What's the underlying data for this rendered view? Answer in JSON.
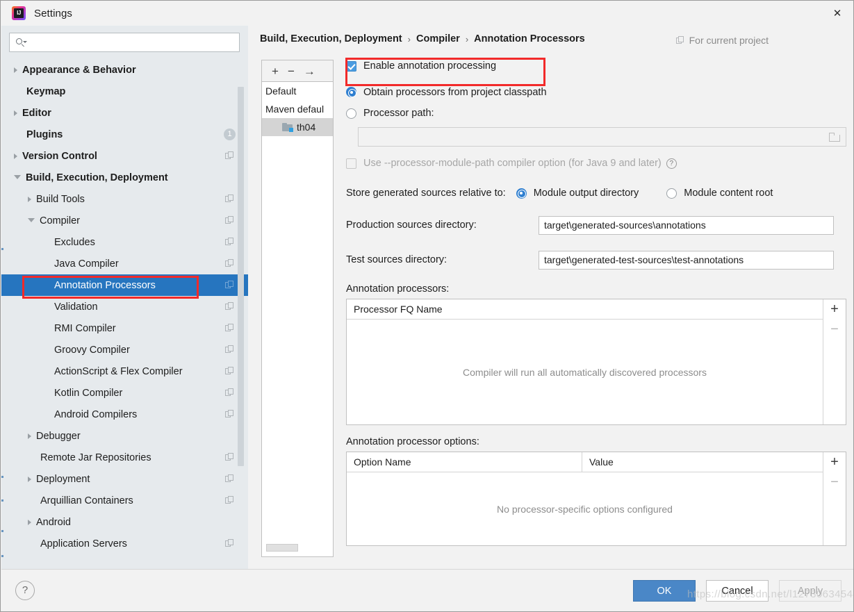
{
  "window": {
    "title": "Settings",
    "logo_icon": "intellij-idea-logo",
    "close_icon": "✕"
  },
  "search": {
    "value": "",
    "placeholder": "",
    "icon": "search-icon"
  },
  "sidebar": {
    "items": [
      {
        "label": "Appearance & Behavior",
        "arrow": "right",
        "bold": true,
        "indent": 0,
        "copy": false,
        "badge": null
      },
      {
        "label": "Keymap",
        "arrow": "none",
        "bold": true,
        "indent": 0,
        "copy": false,
        "badge": null
      },
      {
        "label": "Editor",
        "arrow": "right",
        "bold": true,
        "indent": 0,
        "copy": false,
        "badge": null
      },
      {
        "label": "Plugins",
        "arrow": "none",
        "bold": true,
        "indent": 0,
        "copy": false,
        "badge": "1"
      },
      {
        "label": "Version Control",
        "arrow": "right",
        "bold": true,
        "indent": 0,
        "copy": true,
        "badge": null
      },
      {
        "label": "Build, Execution, Deployment",
        "arrow": "down",
        "bold": true,
        "indent": 0,
        "copy": false,
        "badge": null
      },
      {
        "label": "Build Tools",
        "arrow": "right",
        "bold": false,
        "indent": 1,
        "copy": true,
        "badge": null
      },
      {
        "label": "Compiler",
        "arrow": "down",
        "bold": false,
        "indent": 1,
        "copy": true,
        "badge": null
      },
      {
        "label": "Excludes",
        "arrow": "none",
        "bold": false,
        "indent": 2,
        "copy": true,
        "badge": null
      },
      {
        "label": "Java Compiler",
        "arrow": "none",
        "bold": false,
        "indent": 2,
        "copy": true,
        "badge": null
      },
      {
        "label": "Annotation Processors",
        "arrow": "none",
        "bold": false,
        "indent": 2,
        "copy": true,
        "badge": null,
        "selected": true
      },
      {
        "label": "Validation",
        "arrow": "none",
        "bold": false,
        "indent": 2,
        "copy": true,
        "badge": null
      },
      {
        "label": "RMI Compiler",
        "arrow": "none",
        "bold": false,
        "indent": 2,
        "copy": true,
        "badge": null
      },
      {
        "label": "Groovy Compiler",
        "arrow": "none",
        "bold": false,
        "indent": 2,
        "copy": true,
        "badge": null
      },
      {
        "label": "ActionScript & Flex Compiler",
        "arrow": "none",
        "bold": false,
        "indent": 2,
        "copy": true,
        "badge": null
      },
      {
        "label": "Kotlin Compiler",
        "arrow": "none",
        "bold": false,
        "indent": 2,
        "copy": true,
        "badge": null
      },
      {
        "label": "Android Compilers",
        "arrow": "none",
        "bold": false,
        "indent": 2,
        "copy": true,
        "badge": null
      },
      {
        "label": "Debugger",
        "arrow": "right",
        "bold": false,
        "indent": 1,
        "copy": false,
        "badge": null
      },
      {
        "label": "Remote Jar Repositories",
        "arrow": "none",
        "bold": false,
        "indent": 1,
        "copy": true,
        "badge": null
      },
      {
        "label": "Deployment",
        "arrow": "right",
        "bold": false,
        "indent": 1,
        "copy": true,
        "badge": null
      },
      {
        "label": "Arquillian Containers",
        "arrow": "none",
        "bold": false,
        "indent": 1,
        "copy": true,
        "badge": null
      },
      {
        "label": "Android",
        "arrow": "right",
        "bold": false,
        "indent": 1,
        "copy": false,
        "badge": null
      },
      {
        "label": "Application Servers",
        "arrow": "none",
        "bold": false,
        "indent": 1,
        "copy": true,
        "badge": null
      }
    ]
  },
  "breadcrumb": {
    "parts": [
      "Build, Execution, Deployment",
      "Compiler",
      "Annotation Processors"
    ],
    "separator": "›",
    "for_project_label": "For current project",
    "for_project_icon": "copy-icon"
  },
  "profiles": {
    "toolbar": {
      "add": "+",
      "remove": "−",
      "move": "→"
    },
    "items": [
      {
        "label": "Default",
        "indented": false,
        "selected": false,
        "icon": null
      },
      {
        "label": "Maven defaul",
        "indented": false,
        "selected": false,
        "icon": null
      },
      {
        "label": "th04",
        "indented": true,
        "selected": true,
        "icon": "folder-icon"
      }
    ]
  },
  "main": {
    "enable_annotation_processing": {
      "label": "Enable annotation processing",
      "checked": true
    },
    "processor_source": {
      "options": [
        {
          "label": "Obtain processors from project classpath",
          "selected": true
        },
        {
          "label": "Processor path:",
          "selected": false
        }
      ]
    },
    "processor_path_value": "",
    "processor_path_browse_icon": "folder-browse-icon",
    "module_path_option": {
      "label": "Use --processor-module-path compiler option (for Java 9 and later)",
      "checked": false,
      "disabled": true,
      "help_icon": "?"
    },
    "store_generated": {
      "label": "Store generated sources relative to:",
      "options": [
        {
          "label": "Module output directory",
          "selected": true
        },
        {
          "label": "Module content root",
          "selected": false
        }
      ]
    },
    "production_sources": {
      "label": "Production sources directory:",
      "value": "target\\generated-sources\\annotations"
    },
    "test_sources": {
      "label": "Test sources directory:",
      "value": "target\\generated-test-sources\\test-annotations"
    },
    "processors_table": {
      "label": "Annotation processors:",
      "columns": [
        "Processor FQ Name"
      ],
      "rows": [],
      "empty_text": "Compiler will run all automatically discovered processors",
      "add_label": "+",
      "remove_label": "−"
    },
    "options_table": {
      "label": "Annotation processor options:",
      "columns": [
        "Option Name",
        "Value"
      ],
      "rows": [],
      "empty_text": "No processor-specific options configured",
      "add_label": "+",
      "remove_label": "−"
    }
  },
  "footer": {
    "help_label": "?",
    "ok_label": "OK",
    "cancel_label": "Cancel",
    "apply_label": "Apply"
  },
  "watermark": {
    "text": "https://blog.csdn.net/l12730634544"
  },
  "colors": {
    "accent_blue": "#2675bf",
    "highlight_red": "#f22a2a",
    "sidebar_bg": "#e6eaed",
    "panel_bg": "#f2f2f2",
    "primary_button": "#4a87c7"
  }
}
